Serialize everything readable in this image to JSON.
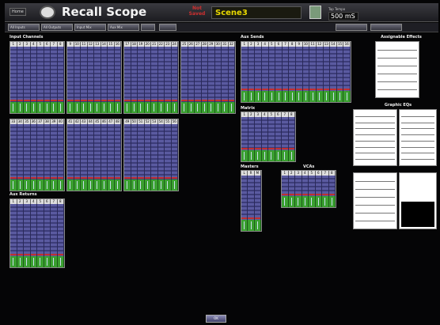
{
  "header": {
    "home_label": "Home",
    "title": "Recall Scope",
    "not_saved": "Not Saved",
    "scene": "Scene3",
    "tap_label": "Tap Tempo",
    "tap_value": "500 mS"
  },
  "toolbar": {
    "buttons": [
      "All Inputs",
      "All Outputs",
      "Input Mix",
      "Aux Mix",
      "",
      "",
      ""
    ]
  },
  "sections": {
    "input_channels": "Input Channels",
    "aux_sends": "Aux Sends",
    "matrix": "Matrix",
    "masters": "Masters",
    "vcas": "VCAs",
    "aux_returns": "Aux Returns",
    "assignable_effects": "Assignable Effects",
    "graphic_eqs": "Graphic EQs"
  },
  "groups": [
    {
      "label": "inputs-1-8",
      "ch": [
        "1",
        "2",
        "3",
        "4",
        "5",
        "6",
        "7",
        "8"
      ]
    },
    {
      "label": "inputs-9-16",
      "ch": [
        "9",
        "10",
        "11",
        "12",
        "13",
        "14",
        "15",
        "16"
      ]
    },
    {
      "label": "inputs-17-24",
      "ch": [
        "17",
        "18",
        "19",
        "20",
        "21",
        "22",
        "23",
        "24"
      ]
    },
    {
      "label": "inputs-25-32",
      "ch": [
        "25",
        "26",
        "27",
        "28",
        "29",
        "30",
        "31",
        "32"
      ]
    },
    {
      "label": "inputs-33-40",
      "ch": [
        "33",
        "34",
        "35",
        "36",
        "37",
        "38",
        "39",
        "40"
      ]
    },
    {
      "label": "inputs-41-48",
      "ch": [
        "41",
        "42",
        "43",
        "44",
        "45",
        "46",
        "47",
        "48"
      ]
    },
    {
      "label": "inputs-49-56",
      "ch": [
        "49",
        "50",
        "51",
        "52",
        "53",
        "54",
        "55",
        "56"
      ]
    },
    {
      "label": "aux-sends",
      "ch": [
        "1",
        "2",
        "3",
        "4",
        "5",
        "6",
        "7",
        "8",
        "9",
        "10",
        "11",
        "12",
        "13",
        "14",
        "15",
        "16"
      ]
    },
    {
      "label": "matrix",
      "ch": [
        "1",
        "2",
        "3",
        "4",
        "5",
        "6",
        "7",
        "8"
      ]
    },
    {
      "label": "masters",
      "ch": [
        "L",
        "R",
        "M"
      ]
    },
    {
      "label": "vcas",
      "ch": [
        "1",
        "2",
        "3",
        "4",
        "5",
        "6",
        "7",
        "8"
      ]
    },
    {
      "label": "aux-returns",
      "ch": [
        "1",
        "2",
        "3",
        "4",
        "5",
        "6",
        "7",
        "8"
      ]
    }
  ],
  "bottom": {
    "label": "OK"
  }
}
